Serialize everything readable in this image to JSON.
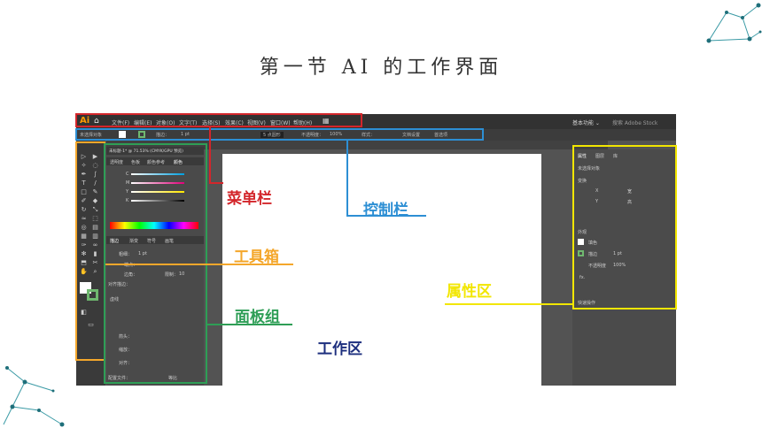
{
  "slide": {
    "title": "第一节   AI 的工作界面"
  },
  "labels": {
    "menubar": "菜单栏",
    "controlbar": "控制栏",
    "toolbox": "工具箱",
    "properties": "属性区",
    "panels": "面板组",
    "workspace": "工作区"
  },
  "colors": {
    "menubar": "#d3262b",
    "controlbar": "#2d8fd4",
    "toolbox": "#f4a72b",
    "properties": "#f2e600",
    "panels": "#2e9e56",
    "workspace": "#1d2f7e"
  },
  "app": {
    "logo": "Ai",
    "menus": [
      "文件(F)",
      "编辑(E)",
      "对象(O)",
      "文字(T)",
      "选择(S)",
      "效果(C)",
      "视图(V)",
      "窗口(W)",
      "帮助(H)"
    ],
    "workspace_switch": "基本功能 ⌄",
    "search_placeholder": "搜索 Adobe Stock",
    "control": {
      "selection": "未选择对象",
      "stroke": "描边：",
      "stroke_value": "1 pt",
      "style": "5 点圆形",
      "opacity": "不透明度：",
      "opacity_value": "100%",
      "style_label": "样式：",
      "doc_setup": "文档设置",
      "prefs": "首选项"
    },
    "doc_tab": "未标题-1* @ 71.53% (CMYK/GPU 预览)",
    "color_panel": {
      "tabs": [
        "透明度",
        "色板",
        "颜色参考",
        "颜色"
      ],
      "channels": [
        "C",
        "M",
        "Y",
        "K"
      ],
      "unit": "%"
    },
    "stroke_panel": {
      "tabs": [
        "描边",
        "渐变",
        "符号",
        "画笔"
      ],
      "weight": "粗细：",
      "weight_value": "1 pt",
      "cap": "端点：",
      "corner": "边角：",
      "limit": "限制：",
      "limit_value": "10",
      "align": "对齐描边：",
      "dashed": "虚线",
      "arrow_start": "箭头：",
      "scale": "缩放：",
      "align_arrows": "对齐：",
      "profile": "配置文件：",
      "profile_value": "等比"
    },
    "properties_panel": {
      "tabs": [
        "属性",
        "图层",
        "库"
      ],
      "selection": "未选择对象",
      "transform": "变换",
      "appearance": "外观",
      "fill": "填色",
      "stroke": "描边",
      "stroke_value": "1 pt",
      "opacity": "不透明度",
      "opacity_value": "100%",
      "fx": "fx.",
      "quick_actions": "快速操作",
      "x": "X",
      "y": "Y",
      "w": "宽",
      "h": "高"
    }
  }
}
